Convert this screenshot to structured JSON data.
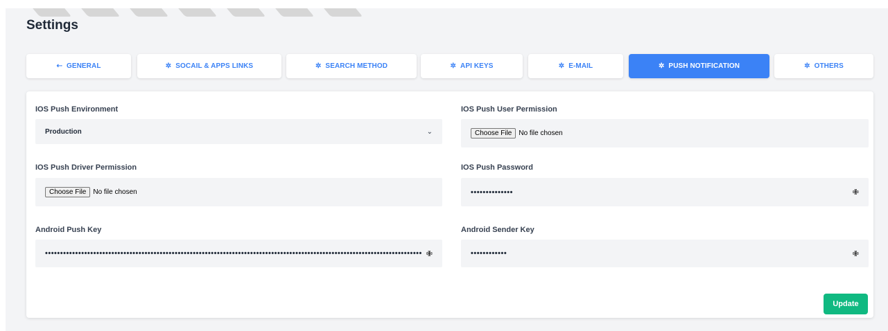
{
  "page": {
    "title": "Settings"
  },
  "tabs": [
    {
      "label": "GENERAL",
      "icon": "arrow-left-icon",
      "glyph": "⇠",
      "active": false
    },
    {
      "label": "SOCAIL & APPS LINKS",
      "icon": "gear-icon",
      "glyph": "✲",
      "active": false
    },
    {
      "label": "SEARCH METHOD",
      "icon": "gear-icon",
      "glyph": "✲",
      "active": false
    },
    {
      "label": "API KEYS",
      "icon": "gear-icon",
      "glyph": "✲",
      "active": false
    },
    {
      "label": "E-MAIL",
      "icon": "gear-icon",
      "glyph": "✲",
      "active": false
    },
    {
      "label": "PUSH NOTIFICATION",
      "icon": "gear-icon",
      "glyph": "✲",
      "active": true
    },
    {
      "label": "OTHERS",
      "icon": "gear-icon",
      "glyph": "✲",
      "active": false
    }
  ],
  "form": {
    "ios_push_environment": {
      "label": "IOS Push Environment",
      "value": "Production"
    },
    "ios_push_user_permission": {
      "label": "IOS Push User Permission",
      "button": "Choose File",
      "status": "No file chosen"
    },
    "ios_push_driver_permission": {
      "label": "IOS Push Driver Permission",
      "button": "Choose File",
      "status": "No file chosen"
    },
    "ios_push_password": {
      "label": "IOS Push Password",
      "value": "••••••••••••••"
    },
    "android_push_key": {
      "label": "Android Push Key",
      "value": "••••••••••••••••••••••••••••••••••••••••••••••••••••••••••••••••••••••••••••••••••••••••••••••••••••••••••••••••••••••••••••••••••••••••••••"
    },
    "android_sender_key": {
      "label": "Android Sender Key",
      "value": "••••••••••••"
    }
  },
  "actions": {
    "update_label": "Update"
  },
  "colors": {
    "accent": "#3b82f6",
    "success": "#10b981",
    "background": "#f3f4f6"
  }
}
